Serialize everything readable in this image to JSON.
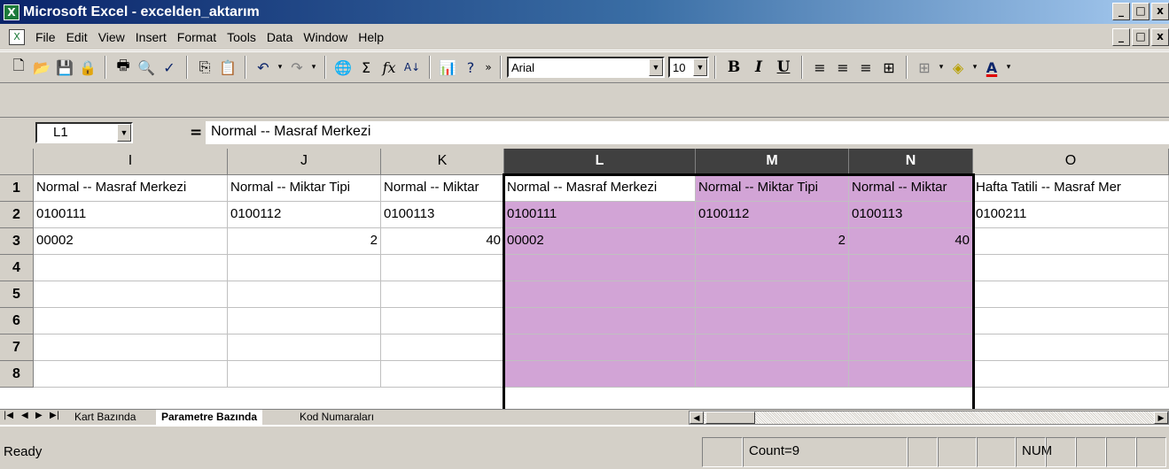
{
  "window": {
    "title": "Microsoft Excel - excelden_aktarım",
    "app_icon": "X",
    "controls": [
      "_",
      "□",
      "x"
    ]
  },
  "menu": {
    "items": [
      "File",
      "Edit",
      "View",
      "Insert",
      "Format",
      "Tools",
      "Data",
      "Window",
      "Help"
    ]
  },
  "toolbar": {
    "font_name": "Arial",
    "font_size": "10",
    "bold_label": "B",
    "italic_label": "I",
    "underline_label": "U"
  },
  "formula_bar": {
    "name_box": "L1",
    "equals": "=",
    "content": "Normal -- Masraf Merkezi"
  },
  "grid": {
    "columns": [
      "I",
      "J",
      "K",
      "L",
      "M",
      "N",
      "O"
    ],
    "selected_columns": [
      "L",
      "M",
      "N"
    ],
    "rows": [
      "1",
      "2",
      "3",
      "4",
      "5",
      "6",
      "7",
      "8"
    ],
    "row1": [
      "Normal -- Masraf Merkezi",
      "Normal -- Miktar Tipi",
      "Normal -- Miktar",
      "Normal -- Masraf Merkezi",
      "Normal -- Miktar Tipi",
      "Normal -- Miktar",
      "Hafta Tatili -- Masraf Mer"
    ],
    "row2": [
      "0100111",
      "0100112",
      "0100113",
      "0100111",
      "0100112",
      "0100113",
      "0100211"
    ],
    "row3": [
      "00002",
      "2",
      "40",
      "00002",
      "2",
      "40",
      ""
    ],
    "highlight_color": "#d2a4d6"
  },
  "sheet_tabs": [
    "Kart Bazında",
    "Parametre Bazında",
    "Kod Numaraları"
  ],
  "active_sheet": "Parametre Bazında",
  "status": {
    "ready": "Ready",
    "count": "Count=9",
    "num": "NUM"
  }
}
